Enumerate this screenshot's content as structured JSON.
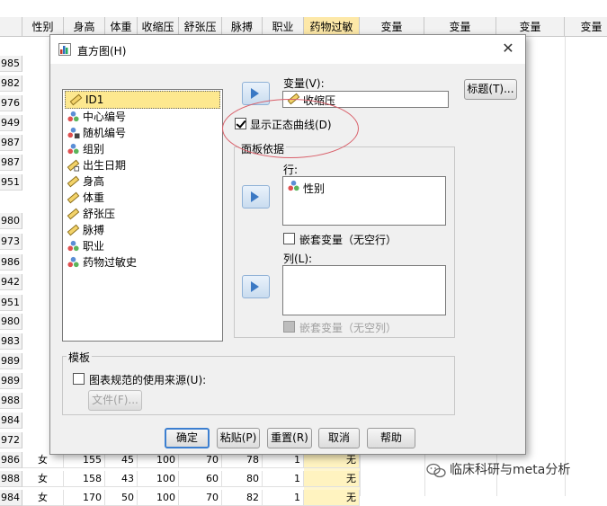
{
  "spreadsheet": {
    "columns": [
      "性别",
      "身高",
      "体重",
      "收缩压",
      "舒张压",
      "脉搏",
      "职业",
      "药物过敏",
      "变量",
      "变量",
      "变量",
      "变量"
    ],
    "row_ids": [
      "985",
      "982",
      "976",
      "949",
      "987",
      "987",
      "951",
      "980",
      "973",
      "986",
      "942",
      "951",
      "980",
      "983",
      "989",
      "989",
      "988",
      "984",
      "972",
      "986",
      "988",
      "984"
    ],
    "visible_rows": [
      {
        "row": "986",
        "sex": "女",
        "height": "155",
        "weight": "45",
        "sbp": "100",
        "dbp": "70",
        "pulse": "78",
        "job": "1",
        "allergy": "无"
      },
      {
        "row": "988",
        "sex": "女",
        "height": "158",
        "weight": "43",
        "sbp": "100",
        "dbp": "60",
        "pulse": "80",
        "job": "1",
        "allergy": "无"
      },
      {
        "row": "984",
        "sex": "女",
        "height": "170",
        "weight": "50",
        "sbp": "100",
        "dbp": "70",
        "pulse": "82",
        "job": "1",
        "allergy": "无"
      }
    ]
  },
  "dialog": {
    "title": "直方图(H)",
    "close_label": "✕",
    "variables": [
      "ID1",
      "中心编号",
      "随机编号",
      "组别",
      "出生日期",
      "身高",
      "体重",
      "舒张压",
      "脉搏",
      "职业",
      "药物过敏史"
    ],
    "variable_icons": [
      "scale-ruler-icon",
      "nominal-icon",
      "nominal-text-icon",
      "nominal-icon",
      "date-ruler-icon",
      "scale-ruler-icon",
      "scale-ruler-icon",
      "scale-ruler-icon",
      "scale-ruler-icon",
      "nominal-icon",
      "nominal-icon"
    ],
    "selected_variable": "ID1",
    "variable_label": "变量(V):",
    "variable_value": "收缩压",
    "titles_button": "标题(T)...",
    "show_normal_curve": "显示正态曲线(D)",
    "show_normal_curve_checked": true,
    "panel_group": "面板依据",
    "row_label": "行:",
    "row_value": "性别",
    "nest_rows": "嵌套变量（无空行）",
    "col_label": "列(L):",
    "nest_cols": "嵌套变量（无空列）",
    "template_group": "模板",
    "use_template": "图表规范的使用来源(U):",
    "file_button": "文件(F)...",
    "buttons": {
      "ok": "确定",
      "paste": "粘贴(P)",
      "reset": "重置(R)",
      "cancel": "取消",
      "help": "帮助"
    }
  },
  "watermark": "临床科研与meta分析",
  "colors": {
    "highlight_column": "#fde8a8",
    "selected_item": "#fde88f",
    "annotation_ellipse": "#d9606a",
    "arrow": "#3a78c4"
  }
}
